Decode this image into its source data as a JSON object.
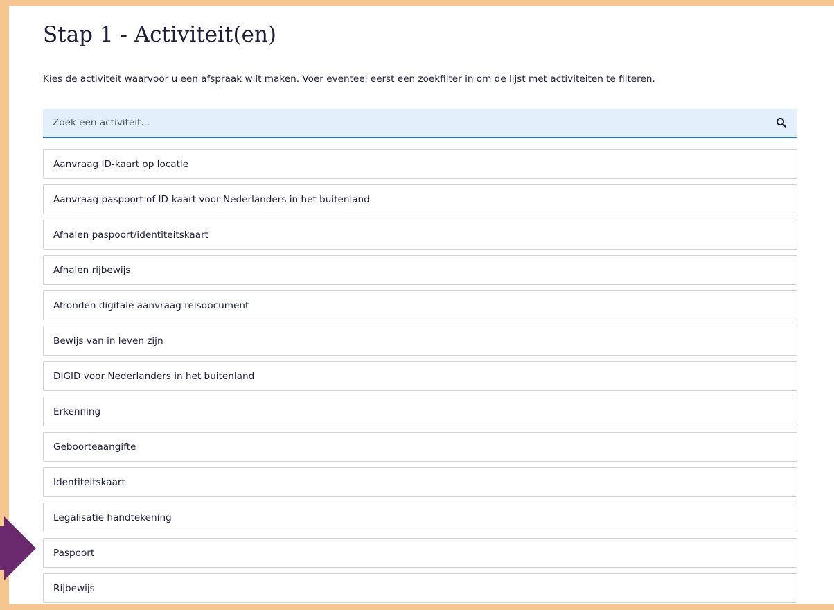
{
  "page": {
    "title": "Stap 1 - Activiteit(en)",
    "intro": "Kies de activiteit waarvoor u een afspraak wilt maken. Voer eventeel eerst een zoekfilter in om de lijst met activiteiten te filteren."
  },
  "search": {
    "placeholder": "Zoek een activiteit...",
    "value": "",
    "icon": "search-icon"
  },
  "activities": [
    "Aanvraag ID-kaart op locatie",
    "Aanvraag paspoort of ID-kaart voor Nederlanders in het buitenland",
    "Afhalen paspoort/identiteitskaart",
    "Afhalen rijbewijs",
    "Afronden digitale aanvraag reisdocument",
    "Bewijs van in leven zijn",
    "DIGID voor Nederlanders in het buitenland",
    "Erkenning",
    "Geboorteaangifte",
    "Identiteitskaart",
    "Legalisatie handtekening",
    "Paspoort",
    "Rijbewijs"
  ],
  "colors": {
    "frame": "#f5c68f",
    "search_background": "#e3effb",
    "search_underline": "#2a6ec2",
    "pointer_arrow": "#6b2a6e",
    "text": "#1c1e3a",
    "item_border": "#cfd3d9"
  },
  "pointer": {
    "icon": "arrow-right-icon",
    "target": "Paspoort"
  }
}
